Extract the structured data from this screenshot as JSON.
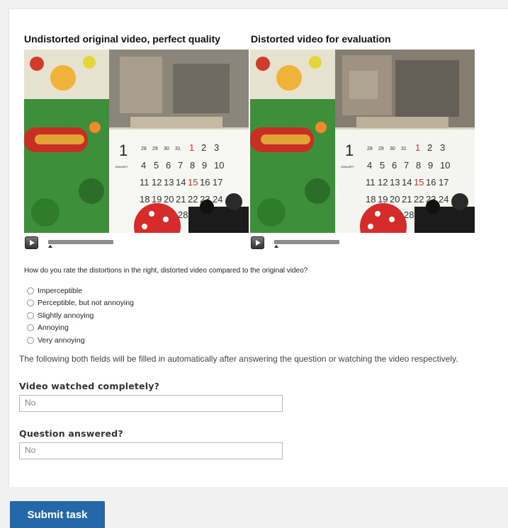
{
  "videos": {
    "original_title": "Undistorted original video, perfect quality",
    "distorted_title": "Distorted video for evaluation",
    "calendar": {
      "month_number": "1",
      "month_name": "JANUARY",
      "row1": [
        "28",
        "29",
        "30",
        "31",
        "1",
        "2",
        "3"
      ],
      "row2": [
        "4",
        "5",
        "6",
        "7",
        "8",
        "9",
        "10"
      ],
      "row3": [
        "11",
        "12",
        "13",
        "14",
        "15",
        "16",
        "17"
      ],
      "row4": [
        "18",
        "19",
        "20",
        "21",
        "22",
        "23",
        "24"
      ],
      "row5_partial": "28"
    }
  },
  "question": {
    "text": "How do you rate the distortions in the right, distorted video compared to the original video?",
    "options": [
      "Imperceptible",
      "Perceptible, but not annoying",
      "Slightly annoying",
      "Annoying",
      "Very annoying"
    ]
  },
  "note": "The following both fields will be filled in automatically after answering the question or watching the video respectively.",
  "fields": {
    "video_watched": {
      "label": "Video watched completely?",
      "value": "No"
    },
    "question_answered": {
      "label": "Question answered?",
      "value": "No"
    }
  },
  "submit_label": "Submit task",
  "colors": {
    "accent": "#2468a9",
    "sunday_red": "#c0392b"
  }
}
